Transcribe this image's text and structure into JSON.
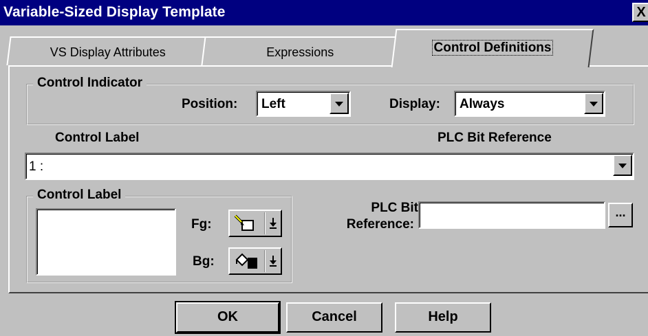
{
  "window": {
    "title": "Variable-Sized Display Template",
    "close_label": "X"
  },
  "tabs": [
    {
      "label": "VS Display Attributes",
      "active": false
    },
    {
      "label": "Expressions",
      "active": false
    },
    {
      "label": "Control Definitions",
      "active": true
    }
  ],
  "control_indicator": {
    "group_title": "Control Indicator",
    "position_label": "Position:",
    "position_value": "Left",
    "display_label": "Display:",
    "display_value": "Always"
  },
  "list_headers": {
    "control_label": "Control Label",
    "plc_bit_reference": "PLC Bit Reference"
  },
  "definition_select": {
    "value": "1 :"
  },
  "control_label_group": {
    "group_title": "Control Label",
    "fg_label": "Fg:",
    "bg_label": "Bg:",
    "fg_icon": "pencil-icon",
    "bg_icon": "paint-bucket-icon"
  },
  "plc_bit": {
    "label_line1": "PLC Bit",
    "label_line2": "Reference:",
    "value": "",
    "browse_label": "..."
  },
  "buttons": {
    "ok": "OK",
    "cancel": "Cancel",
    "help": "Help"
  },
  "colors": {
    "title_bar": "#000080",
    "face": "#c0c0c0"
  }
}
